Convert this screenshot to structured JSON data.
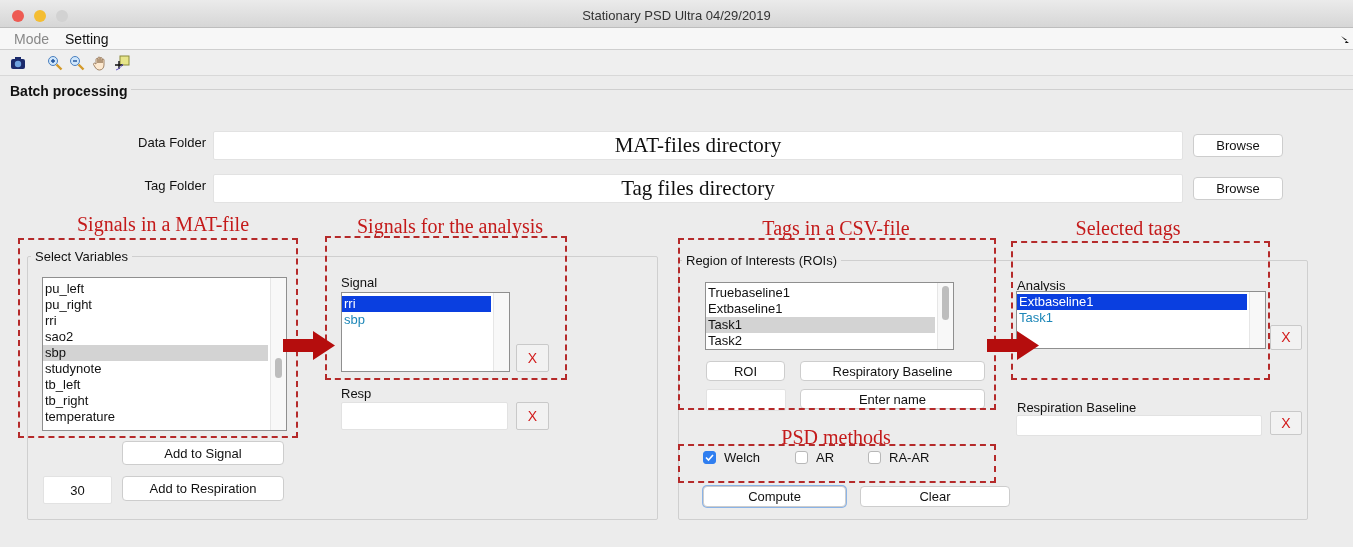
{
  "window": {
    "title": "Stationary PSD Ultra 04/29/2019",
    "buttons": [
      {
        "color": "#ee5b53"
      },
      {
        "color": "#f4bd32"
      },
      {
        "color": "#d2d2d2"
      }
    ]
  },
  "menu": [
    {
      "label": "Mode",
      "disabled": true
    },
    {
      "label": "Setting",
      "disabled": false
    }
  ],
  "batch": {
    "title": "Batch processing",
    "data_folder": {
      "label": "Data Folder",
      "value": "MAT-files directory",
      "button": "Browse"
    },
    "tag_folder": {
      "label": "Tag Folder",
      "value": "Tag files directory",
      "button": "Browse"
    }
  },
  "select_variables": {
    "title": "Select Variables",
    "focused": false,
    "items": [
      {
        "label": "pu_left",
        "selected": false
      },
      {
        "label": "pu_right",
        "selected": false
      },
      {
        "label": "rri",
        "selected": false
      },
      {
        "label": "sao2",
        "selected": false
      },
      {
        "label": "sbp",
        "selected": true
      },
      {
        "label": "studynote",
        "selected": false
      },
      {
        "label": "tb_left",
        "selected": false
      },
      {
        "label": "tb_right",
        "selected": false
      },
      {
        "label": "temperature",
        "selected": false
      }
    ],
    "add_signal_button": "Add to Signal",
    "window_value": "30",
    "add_respiration_button": "Add to Respiration"
  },
  "signal": {
    "label": "Signal",
    "focused": true,
    "items": [
      {
        "label": "rri",
        "selected": true
      },
      {
        "label": "sbp",
        "selected": false
      }
    ],
    "clear_button": "X"
  },
  "resp": {
    "label": "Resp",
    "clear_button": "X"
  },
  "rois": {
    "title": "Region of Interests (ROIs)",
    "focused": false,
    "items": [
      {
        "label": "Truebaseline1",
        "selected": false
      },
      {
        "label": "Extbaseline1",
        "selected": false
      },
      {
        "label": "Task1",
        "selected": true
      },
      {
        "label": "Task2",
        "selected": false
      }
    ],
    "roi_button": "ROI",
    "respiratory_baseline_button": "Respiratory Baseline",
    "enter_name_button": "Enter name"
  },
  "psd_methods": [
    {
      "label": "Welch",
      "checked": true
    },
    {
      "label": "AR",
      "checked": false
    },
    {
      "label": "RA-AR",
      "checked": false
    }
  ],
  "compute_button": "Compute",
  "clear_button": "Clear",
  "analysis": {
    "label": "Analysis",
    "focused": true,
    "items": [
      {
        "label": "Extbaseline1",
        "selected": true
      },
      {
        "label": "Task1",
        "selected": false
      }
    ],
    "clear_button": "X"
  },
  "respiration_baseline": {
    "label": "Respiration Baseline",
    "clear_button": "X"
  },
  "annotations": [
    "Signals in a MAT-file",
    "Signals for the analysis",
    "Tags in a CSV-file",
    "Selected tags",
    "PSD methods"
  ]
}
